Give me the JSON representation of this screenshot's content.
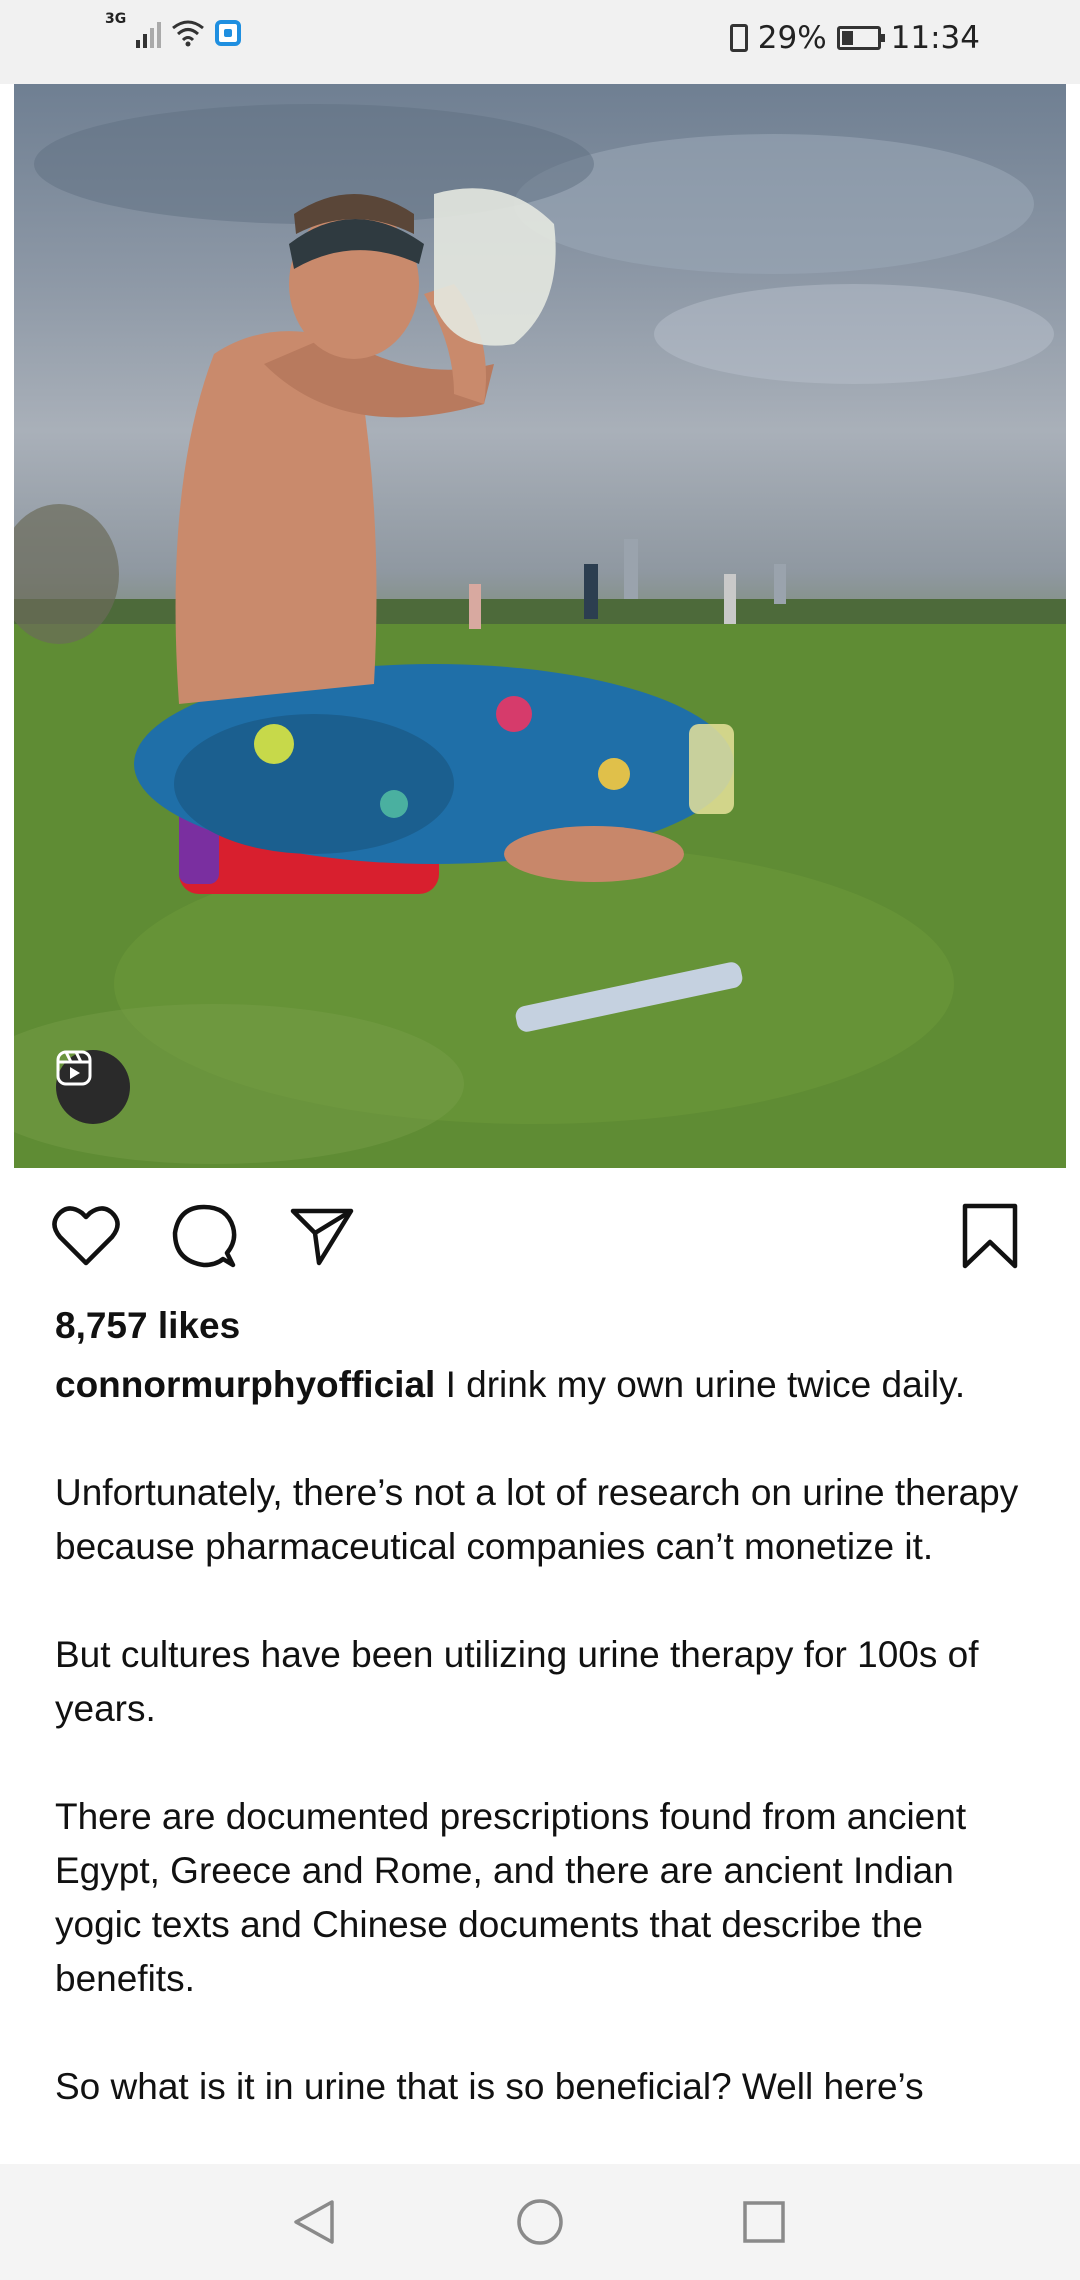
{
  "status_bar": {
    "network_type": "3G",
    "battery_percent": "29%",
    "time": "11:34"
  },
  "post": {
    "image_description_icon": "reel-icon",
    "likes": "8,757 likes",
    "username": "connormurphyofficial",
    "caption_first_line": " I drink my own urine twice daily.",
    "caption_paragraphs": [
      "Unfortunately, there’s not a lot of research on urine therapy because pharmaceutical companies can’t monetize it.",
      "But cultures have been utilizing urine therapy for 100s of years.",
      "There are documented prescriptions found from ancient Egypt, Greece and Rome, and there are ancient Indian yogic texts and Chinese documents that describe the benefits.",
      "So what is it in urine that is so beneficial? Well here’s"
    ]
  },
  "actions": {
    "like_icon": "heart-icon",
    "comment_icon": "comment-icon",
    "share_icon": "send-icon",
    "save_icon": "bookmark-icon"
  },
  "nav_bar": {
    "back_icon": "back-triangle-icon",
    "home_icon": "home-circle-icon",
    "recents_icon": "recents-square-icon"
  }
}
